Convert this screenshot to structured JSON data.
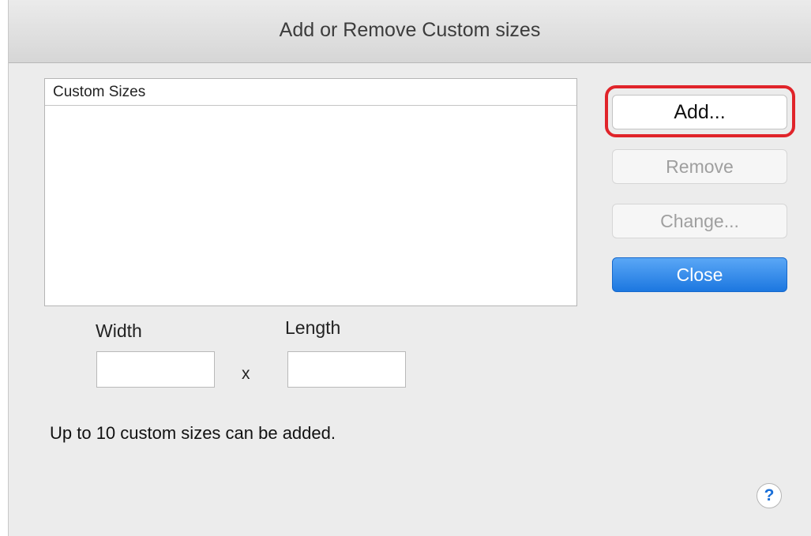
{
  "window": {
    "title": "Add or Remove Custom sizes"
  },
  "list": {
    "header": "Custom Sizes",
    "items": []
  },
  "buttons": {
    "add_label": "Add...",
    "remove_label": "Remove",
    "change_label": "Change...",
    "close_label": "Close"
  },
  "dimensions": {
    "width_label": "Width",
    "width_value": "",
    "length_label": "Length",
    "length_value": "",
    "separator": "x"
  },
  "note": "Up to 10 custom sizes can be added.",
  "help": {
    "glyph": "?",
    "icon": "help-icon"
  },
  "colors": {
    "highlight": "#e0242a",
    "primary_button": "#1c77e0"
  }
}
